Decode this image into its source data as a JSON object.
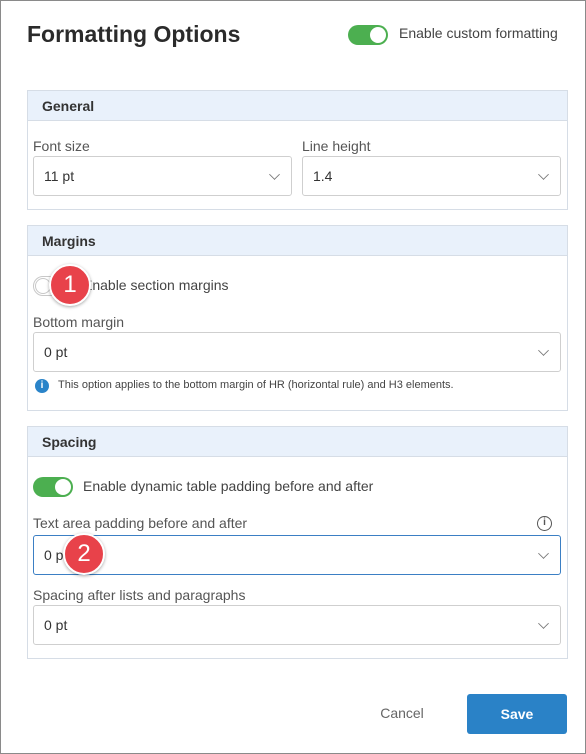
{
  "dialog": {
    "title": "Formatting Options",
    "custom_formatting": {
      "label": "Enable custom formatting",
      "enabled": true
    }
  },
  "sections": {
    "general": {
      "title": "General",
      "font_size": {
        "label": "Font size",
        "value": "11 pt"
      },
      "line_height": {
        "label": "Line height",
        "value": "1.4"
      }
    },
    "margins": {
      "title": "Margins",
      "section_margins": {
        "label": "Enable section margins",
        "enabled": false
      },
      "bottom_margin": {
        "label": "Bottom margin",
        "value": "0 pt"
      },
      "note": "This option applies to the bottom margin of HR (horizontal rule) and H3 elements."
    },
    "spacing": {
      "title": "Spacing",
      "dynamic_padding": {
        "label": "Enable dynamic table padding before and after",
        "enabled": true
      },
      "text_area_padding": {
        "label": "Text area padding before and after",
        "value": "0 pt"
      },
      "after_lists": {
        "label": "Spacing after lists and paragraphs",
        "value": "0 pt"
      }
    }
  },
  "callouts": [
    "1",
    "2"
  ],
  "footer": {
    "cancel_label": "Cancel",
    "save_label": "Save"
  },
  "colors": {
    "accent": "#2a82c7",
    "toggle_on": "#4caf50",
    "section_header": "#e9f1fb",
    "callout": "#e8424a"
  }
}
